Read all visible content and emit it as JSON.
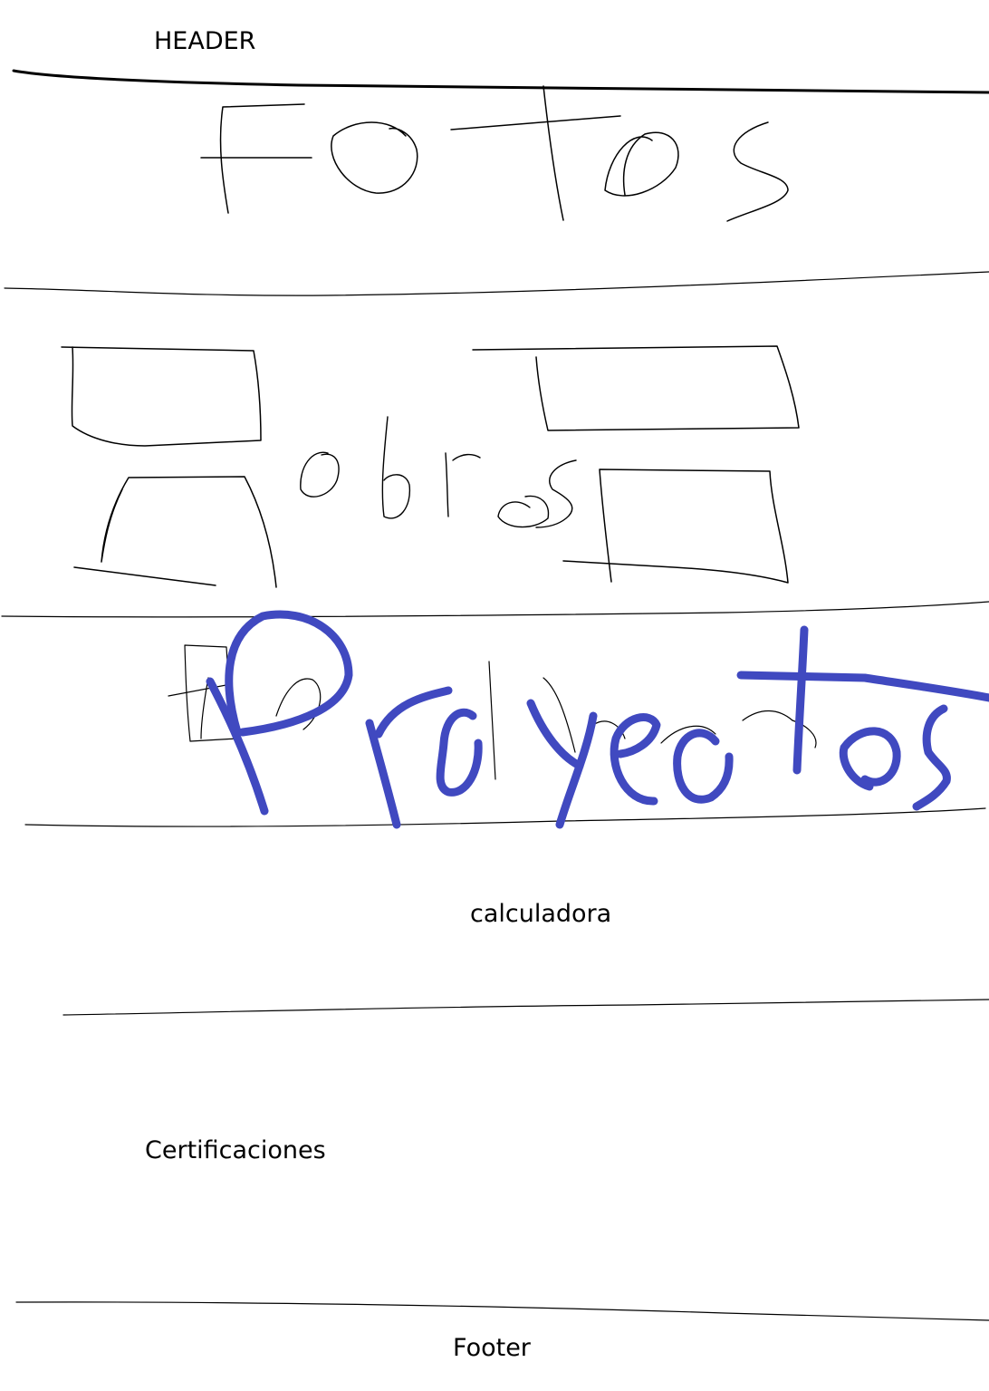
{
  "sections": {
    "header": {
      "label": "HEADER"
    },
    "fotos": {
      "label": "Fotos"
    },
    "obras": {
      "label": "obras"
    },
    "proyectos": {
      "label": "Proyectos",
      "stroke_color": "#4049c0"
    },
    "calculadora": {
      "label": "calculadora"
    },
    "certificaciones": {
      "label": "Certificaciones"
    },
    "footer": {
      "label": "Footer"
    }
  },
  "colors": {
    "ink": "#000000",
    "marker": "#4049c0",
    "background": "#ffffff"
  }
}
